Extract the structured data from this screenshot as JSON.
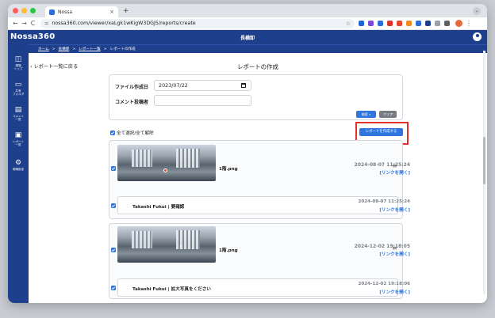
{
  "browser": {
    "tab_title": "Nossa",
    "tab_close": "×",
    "new_tab": "+",
    "url": "nossa360.com/viewer/xaLgk1wKigW3DGJ5/reports/create",
    "nav_back": "←",
    "nav_forward": "→",
    "nav_reload": "C",
    "tab_list": "⌄",
    "extension_colors": [
      "#1f66d1",
      "#7a4bd6",
      "#2b6fd6",
      "#e0322b",
      "#e6452f",
      "#f08a1c",
      "#2b6fd6",
      "#1e3f8c",
      "#9aa0a6",
      "#5f6368"
    ]
  },
  "app": {
    "logo": "Nossa360",
    "header_title": "長横卸",
    "accent_color": "#1e3f8c"
  },
  "sidebar": {
    "items": [
      {
        "icon": "map-icon",
        "glyph": "◫",
        "label": "現場\nトップ"
      },
      {
        "icon": "folder-icon",
        "glyph": "▭",
        "label": "共有\nフォルダ"
      },
      {
        "icon": "comment-icon",
        "glyph": "▤",
        "label": "コメント\n一覧"
      },
      {
        "icon": "report-icon",
        "glyph": "▣",
        "label": "レポート\n一覧"
      },
      {
        "icon": "settings-icon",
        "glyph": "⚙",
        "label": "現場設定"
      }
    ]
  },
  "breadcrumb": {
    "items": [
      "ホーム",
      "長横卸",
      "レポート一覧",
      "レポートの作成"
    ],
    "separator": ">"
  },
  "page": {
    "back_label": "レポート一覧に戻る",
    "title": "レポートの作成"
  },
  "search": {
    "date_label": "ファイル作成日",
    "date_value": "2023/07/22",
    "commenter_label": "コメント投稿者",
    "commenter_value": "",
    "search_button": "検索",
    "clear_button": "クリア"
  },
  "list": {
    "select_all_label": "全て選択/全て解除",
    "create_button": "レポートを作成する"
  },
  "reports": [
    {
      "file_name": "1階.png",
      "date": "2024-08-07 11:25:24",
      "link": "[リンクを開く]",
      "comment": {
        "text": "Takashi Fukui | 要確認",
        "date": "2024-08-07 11:25:24",
        "link": "[リンクを開く]"
      }
    },
    {
      "file_name": "1階.png",
      "date": "2024-12-02 19:18:05",
      "link": "[リンクを開く]",
      "comment": {
        "text": "Takashi Fukui | 拡大写真をください",
        "date": "2024-12-02 19:18:06",
        "link": "[リンクを開く]"
      }
    }
  ]
}
